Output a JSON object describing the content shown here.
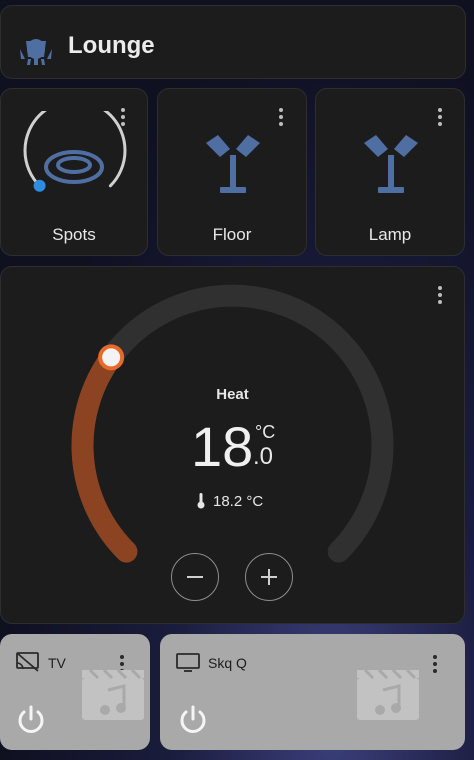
{
  "room": {
    "title": "Lounge",
    "icon": "ceiling-lights-icon"
  },
  "lights": [
    {
      "label": "Spots",
      "icon": "ceiling-light-icon",
      "brightness_pct": 0
    },
    {
      "label": "Floor",
      "icon": "floor-lamp-icon"
    },
    {
      "label": "Lamp",
      "icon": "floor-lamp-icon"
    }
  ],
  "thermostat": {
    "mode": "Heat",
    "target_int": "18",
    "target_unit": "°C",
    "target_dec": ".0",
    "current_temp": "18.2 °C",
    "arc_fill_fraction": 0.3,
    "accent": "#8b4322"
  },
  "media": [
    {
      "name": "TV",
      "icon": "cast-off-icon"
    },
    {
      "name": "Skq Q",
      "icon": "television-icon"
    }
  ]
}
